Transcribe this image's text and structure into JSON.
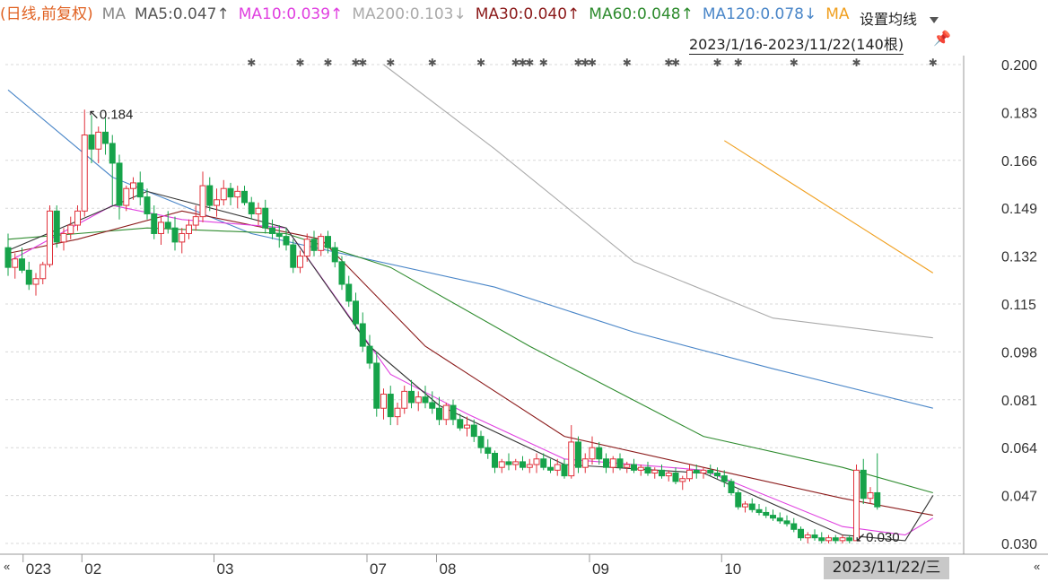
{
  "legend": {
    "mode": "(日线,前复权)",
    "ma": "MA",
    "ma5": "MA5:0.047↑",
    "ma10": "MA10:0.039↑",
    "ma200": "MA200:0.103↓",
    "ma30": "MA30:0.040↑",
    "ma60": "MA60:0.048↑",
    "ma120": "MA120:0.078↓",
    "ma250_partial": "MA"
  },
  "settings_label": "设置均线",
  "range_label": "2023/1/16-2023/11/22(140根)",
  "date_box": "2023/11/22/三",
  "nav_left": "«",
  "nav_right": "«",
  "colors": {
    "up": "#e0303a",
    "down": "#16a34a",
    "ma5": "#333333",
    "ma10": "#e040e0",
    "ma30": "#8b1a1a",
    "ma60": "#2e8b2e",
    "ma120": "#4a86c8",
    "ma200": "#aaaaaa",
    "ma250": "#f0a020"
  },
  "chart_data": {
    "type": "candlestick",
    "y_ticks": [
      "0.200",
      "0.183",
      "0.166",
      "0.149",
      "0.132",
      "0.115",
      "0.098",
      "0.081",
      "0.064",
      "0.047",
      "0.030"
    ],
    "ylim": [
      0.03,
      0.2
    ],
    "x_ticks": [
      "023",
      "02",
      "03",
      "07",
      "08",
      "09",
      "10"
    ],
    "annotations": {
      "high": "0.184",
      "low": "0.030"
    },
    "n_bars": 140,
    "ohlc": [
      [
        0.135,
        0.14,
        0.125,
        0.128
      ],
      [
        0.128,
        0.133,
        0.124,
        0.131
      ],
      [
        0.131,
        0.135,
        0.126,
        0.127
      ],
      [
        0.127,
        0.13,
        0.12,
        0.122
      ],
      [
        0.122,
        0.126,
        0.118,
        0.124
      ],
      [
        0.124,
        0.13,
        0.122,
        0.129
      ],
      [
        0.129,
        0.15,
        0.128,
        0.148
      ],
      [
        0.148,
        0.15,
        0.135,
        0.137
      ],
      [
        0.137,
        0.142,
        0.134,
        0.14
      ],
      [
        0.14,
        0.146,
        0.138,
        0.143
      ],
      [
        0.143,
        0.15,
        0.141,
        0.148
      ],
      [
        0.148,
        0.184,
        0.146,
        0.175
      ],
      [
        0.175,
        0.182,
        0.165,
        0.17
      ],
      [
        0.17,
        0.178,
        0.165,
        0.176
      ],
      [
        0.176,
        0.181,
        0.168,
        0.172
      ],
      [
        0.172,
        0.175,
        0.15,
        0.165
      ],
      [
        0.165,
        0.168,
        0.145,
        0.15
      ],
      [
        0.15,
        0.157,
        0.148,
        0.156
      ],
      [
        0.156,
        0.16,
        0.152,
        0.158
      ],
      [
        0.158,
        0.162,
        0.15,
        0.153
      ],
      [
        0.153,
        0.156,
        0.145,
        0.147
      ],
      [
        0.147,
        0.15,
        0.138,
        0.14
      ],
      [
        0.14,
        0.146,
        0.136,
        0.144
      ],
      [
        0.144,
        0.148,
        0.14,
        0.142
      ],
      [
        0.142,
        0.146,
        0.134,
        0.137
      ],
      [
        0.137,
        0.142,
        0.133,
        0.14
      ],
      [
        0.14,
        0.145,
        0.138,
        0.143
      ],
      [
        0.143,
        0.15,
        0.141,
        0.146
      ],
      [
        0.146,
        0.162,
        0.144,
        0.157
      ],
      [
        0.157,
        0.16,
        0.148,
        0.15
      ],
      [
        0.15,
        0.156,
        0.146,
        0.152
      ],
      [
        0.152,
        0.159,
        0.15,
        0.156
      ],
      [
        0.156,
        0.158,
        0.15,
        0.153
      ],
      [
        0.153,
        0.157,
        0.149,
        0.155
      ],
      [
        0.155,
        0.157,
        0.15,
        0.151
      ],
      [
        0.151,
        0.153,
        0.145,
        0.147
      ],
      [
        0.147,
        0.151,
        0.143,
        0.149
      ],
      [
        0.149,
        0.152,
        0.14,
        0.142
      ],
      [
        0.142,
        0.145,
        0.138,
        0.14
      ],
      [
        0.14,
        0.143,
        0.135,
        0.139
      ],
      [
        0.139,
        0.142,
        0.134,
        0.136
      ],
      [
        0.136,
        0.138,
        0.126,
        0.128
      ],
      [
        0.128,
        0.134,
        0.126,
        0.132
      ],
      [
        0.132,
        0.14,
        0.13,
        0.138
      ],
      [
        0.138,
        0.141,
        0.132,
        0.134
      ],
      [
        0.134,
        0.14,
        0.132,
        0.139
      ],
      [
        0.139,
        0.141,
        0.133,
        0.135
      ],
      [
        0.135,
        0.137,
        0.128,
        0.13
      ],
      [
        0.13,
        0.132,
        0.12,
        0.122
      ],
      [
        0.122,
        0.125,
        0.114,
        0.116
      ],
      [
        0.116,
        0.119,
        0.106,
        0.108
      ],
      [
        0.108,
        0.112,
        0.098,
        0.1
      ],
      [
        0.1,
        0.104,
        0.092,
        0.094
      ],
      [
        0.094,
        0.098,
        0.075,
        0.078
      ],
      [
        0.078,
        0.085,
        0.074,
        0.083
      ],
      [
        0.083,
        0.086,
        0.072,
        0.075
      ],
      [
        0.075,
        0.08,
        0.072,
        0.078
      ],
      [
        0.078,
        0.086,
        0.076,
        0.084
      ],
      [
        0.084,
        0.088,
        0.078,
        0.08
      ],
      [
        0.08,
        0.084,
        0.077,
        0.082
      ],
      [
        0.082,
        0.086,
        0.078,
        0.08
      ],
      [
        0.08,
        0.084,
        0.076,
        0.078
      ],
      [
        0.078,
        0.082,
        0.072,
        0.074
      ],
      [
        0.074,
        0.08,
        0.072,
        0.079
      ],
      [
        0.079,
        0.081,
        0.072,
        0.074
      ],
      [
        0.074,
        0.076,
        0.07,
        0.071
      ],
      [
        0.071,
        0.075,
        0.068,
        0.072
      ],
      [
        0.072,
        0.074,
        0.066,
        0.068
      ],
      [
        0.068,
        0.07,
        0.062,
        0.064
      ],
      [
        0.064,
        0.067,
        0.06,
        0.062
      ],
      [
        0.062,
        0.063,
        0.055,
        0.057
      ],
      [
        0.057,
        0.06,
        0.055,
        0.059
      ],
      [
        0.059,
        0.062,
        0.056,
        0.058
      ],
      [
        0.058,
        0.06,
        0.056,
        0.059
      ],
      [
        0.059,
        0.061,
        0.056,
        0.057
      ],
      [
        0.057,
        0.06,
        0.055,
        0.058
      ],
      [
        0.058,
        0.062,
        0.055,
        0.06
      ],
      [
        0.06,
        0.062,
        0.056,
        0.057
      ],
      [
        0.057,
        0.06,
        0.055,
        0.056
      ],
      [
        0.056,
        0.06,
        0.054,
        0.058
      ],
      [
        0.058,
        0.06,
        0.053,
        0.054
      ],
      [
        0.054,
        0.072,
        0.053,
        0.066
      ],
      [
        0.066,
        0.068,
        0.055,
        0.057
      ],
      [
        0.057,
        0.062,
        0.055,
        0.06
      ],
      [
        0.06,
        0.068,
        0.058,
        0.064
      ],
      [
        0.064,
        0.066,
        0.058,
        0.06
      ],
      [
        0.06,
        0.062,
        0.055,
        0.057
      ],
      [
        0.057,
        0.061,
        0.055,
        0.06
      ],
      [
        0.06,
        0.062,
        0.056,
        0.057
      ],
      [
        0.057,
        0.059,
        0.055,
        0.058
      ],
      [
        0.058,
        0.06,
        0.055,
        0.056
      ],
      [
        0.056,
        0.058,
        0.054,
        0.057
      ],
      [
        0.057,
        0.059,
        0.054,
        0.055
      ],
      [
        0.055,
        0.057,
        0.053,
        0.056
      ],
      [
        0.056,
        0.058,
        0.053,
        0.054
      ],
      [
        0.054,
        0.056,
        0.052,
        0.055
      ],
      [
        0.055,
        0.057,
        0.051,
        0.052
      ],
      [
        0.052,
        0.054,
        0.049,
        0.053
      ],
      [
        0.053,
        0.058,
        0.052,
        0.056
      ],
      [
        0.056,
        0.058,
        0.053,
        0.055
      ],
      [
        0.055,
        0.057,
        0.053,
        0.056
      ],
      [
        0.056,
        0.058,
        0.054,
        0.055
      ],
      [
        0.055,
        0.057,
        0.053,
        0.054
      ],
      [
        0.054,
        0.056,
        0.05,
        0.052
      ],
      [
        0.052,
        0.053,
        0.047,
        0.048
      ],
      [
        0.048,
        0.049,
        0.042,
        0.043
      ],
      [
        0.043,
        0.045,
        0.041,
        0.044
      ],
      [
        0.044,
        0.046,
        0.041,
        0.042
      ],
      [
        0.042,
        0.044,
        0.04,
        0.041
      ],
      [
        0.041,
        0.043,
        0.039,
        0.04
      ],
      [
        0.04,
        0.042,
        0.038,
        0.039
      ],
      [
        0.039,
        0.041,
        0.037,
        0.038
      ],
      [
        0.038,
        0.04,
        0.036,
        0.037
      ],
      [
        0.037,
        0.039,
        0.034,
        0.035
      ],
      [
        0.035,
        0.036,
        0.031,
        0.032
      ],
      [
        0.032,
        0.034,
        0.03,
        0.033
      ],
      [
        0.033,
        0.035,
        0.031,
        0.032
      ],
      [
        0.032,
        0.034,
        0.03,
        0.031
      ],
      [
        0.031,
        0.033,
        0.03,
        0.032
      ],
      [
        0.032,
        0.033,
        0.03,
        0.031
      ],
      [
        0.031,
        0.033,
        0.03,
        0.032
      ],
      [
        0.032,
        0.033,
        0.03,
        0.031
      ],
      [
        0.031,
        0.058,
        0.031,
        0.056
      ],
      [
        0.056,
        0.06,
        0.044,
        0.046
      ],
      [
        0.046,
        0.05,
        0.044,
        0.048
      ],
      [
        0.048,
        0.062,
        0.042,
        0.043
      ]
    ],
    "ma_lines": {
      "ma5": [
        [
          0,
          0.134
        ],
        [
          20,
          0.155
        ],
        [
          40,
          0.142
        ],
        [
          52,
          0.1
        ],
        [
          62,
          0.079
        ],
        [
          80,
          0.058
        ],
        [
          100,
          0.055
        ],
        [
          120,
          0.033
        ],
        [
          129,
          0.031
        ],
        [
          133,
          0.047
        ]
      ],
      "ma10": [
        [
          0,
          0.13
        ],
        [
          15,
          0.15
        ],
        [
          25,
          0.145
        ],
        [
          40,
          0.142
        ],
        [
          55,
          0.09
        ],
        [
          66,
          0.076
        ],
        [
          80,
          0.06
        ],
        [
          100,
          0.056
        ],
        [
          120,
          0.036
        ],
        [
          129,
          0.033
        ],
        [
          133,
          0.039
        ]
      ],
      "ma30": [
        [
          0,
          0.133
        ],
        [
          10,
          0.138
        ],
        [
          25,
          0.148
        ],
        [
          45,
          0.138
        ],
        [
          60,
          0.1
        ],
        [
          80,
          0.068
        ],
        [
          100,
          0.057
        ],
        [
          120,
          0.046
        ],
        [
          133,
          0.04
        ]
      ],
      "ma60": [
        [
          0,
          0.138
        ],
        [
          20,
          0.142
        ],
        [
          40,
          0.14
        ],
        [
          55,
          0.128
        ],
        [
          75,
          0.1
        ],
        [
          100,
          0.068
        ],
        [
          120,
          0.057
        ],
        [
          133,
          0.048
        ]
      ],
      "ma120": [
        [
          0,
          0.191
        ],
        [
          15,
          0.16
        ],
        [
          35,
          0.14
        ],
        [
          70,
          0.121
        ],
        [
          90,
          0.105
        ],
        [
          110,
          0.092
        ],
        [
          133,
          0.078
        ]
      ],
      "ma200": [
        [
          54,
          0.2
        ],
        [
          70,
          0.17
        ],
        [
          90,
          0.13
        ],
        [
          110,
          0.11
        ],
        [
          133,
          0.103
        ]
      ],
      "ma250": [
        [
          103,
          0.173
        ],
        [
          133,
          0.126
        ]
      ]
    }
  }
}
